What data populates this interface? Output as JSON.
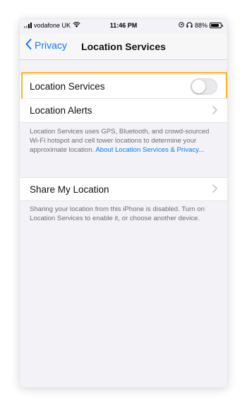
{
  "status_bar": {
    "carrier": "vodafone UK",
    "time": "11:46 PM",
    "battery": "88%",
    "battery_level": 0.88,
    "icons": [
      "signal-icon",
      "wifi-icon",
      "location-arrow-icon",
      "headphones-icon",
      "battery-icon"
    ]
  },
  "nav": {
    "back_label": "Privacy",
    "title": "Location Services"
  },
  "settings": {
    "location_services": {
      "label": "Location Services",
      "enabled": false
    },
    "location_alerts": {
      "label": "Location Alerts"
    },
    "description": "Location Services uses GPS, Bluetooth, and crowd-sourced Wi-Fi hotspot and cell tower locations to determine your approximate location. ",
    "description_link": "About Location Services & Privacy...",
    "share_my_location": {
      "label": "Share My Location"
    },
    "share_note": "Sharing your location from this iPhone is disabled. Turn on Location Services to enable it, or choose another device."
  },
  "colors": {
    "accent": "#0a7aff",
    "highlight": "#f7b81b",
    "background": "#f2f2f7"
  }
}
